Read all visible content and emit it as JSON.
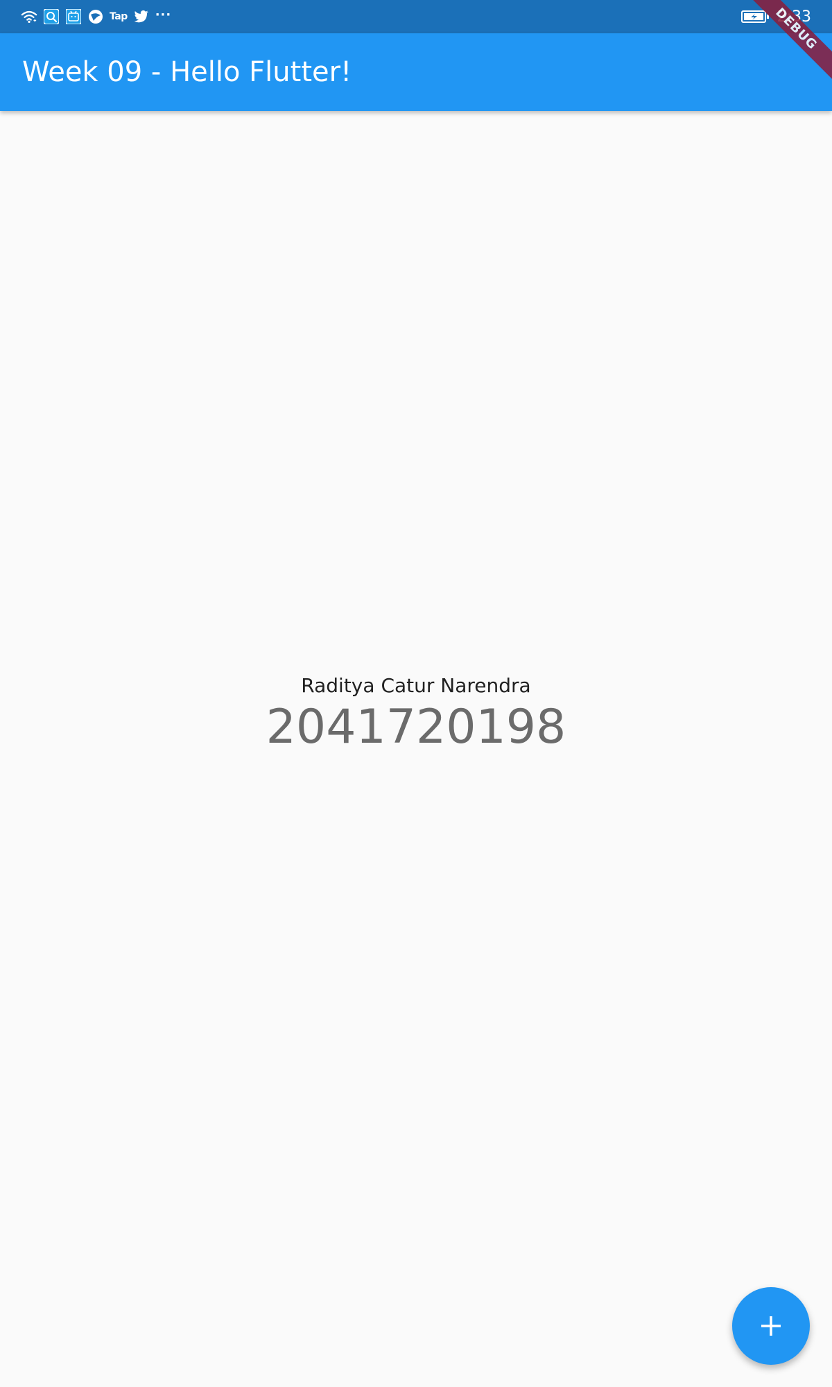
{
  "status_bar": {
    "left_icons": [
      "wifi-icon",
      "search-app-icon",
      "bilibili-icon",
      "browser-icon",
      "tap-icon",
      "twitter-icon",
      "more-icon"
    ],
    "tap_label": "Tap",
    "more_label": "···",
    "battery_icon": "battery-charging-icon",
    "time": "2:33",
    "background_color": "#1b70b8"
  },
  "app_bar": {
    "title": "Week 09 - Hello Flutter!",
    "background_color": "#2196f3"
  },
  "debug_banner": {
    "label": "DEBUG"
  },
  "main": {
    "name": "Raditya Catur Narendra",
    "number": "2041720198"
  },
  "fab": {
    "icon": "add-icon",
    "color": "#2196f3"
  }
}
